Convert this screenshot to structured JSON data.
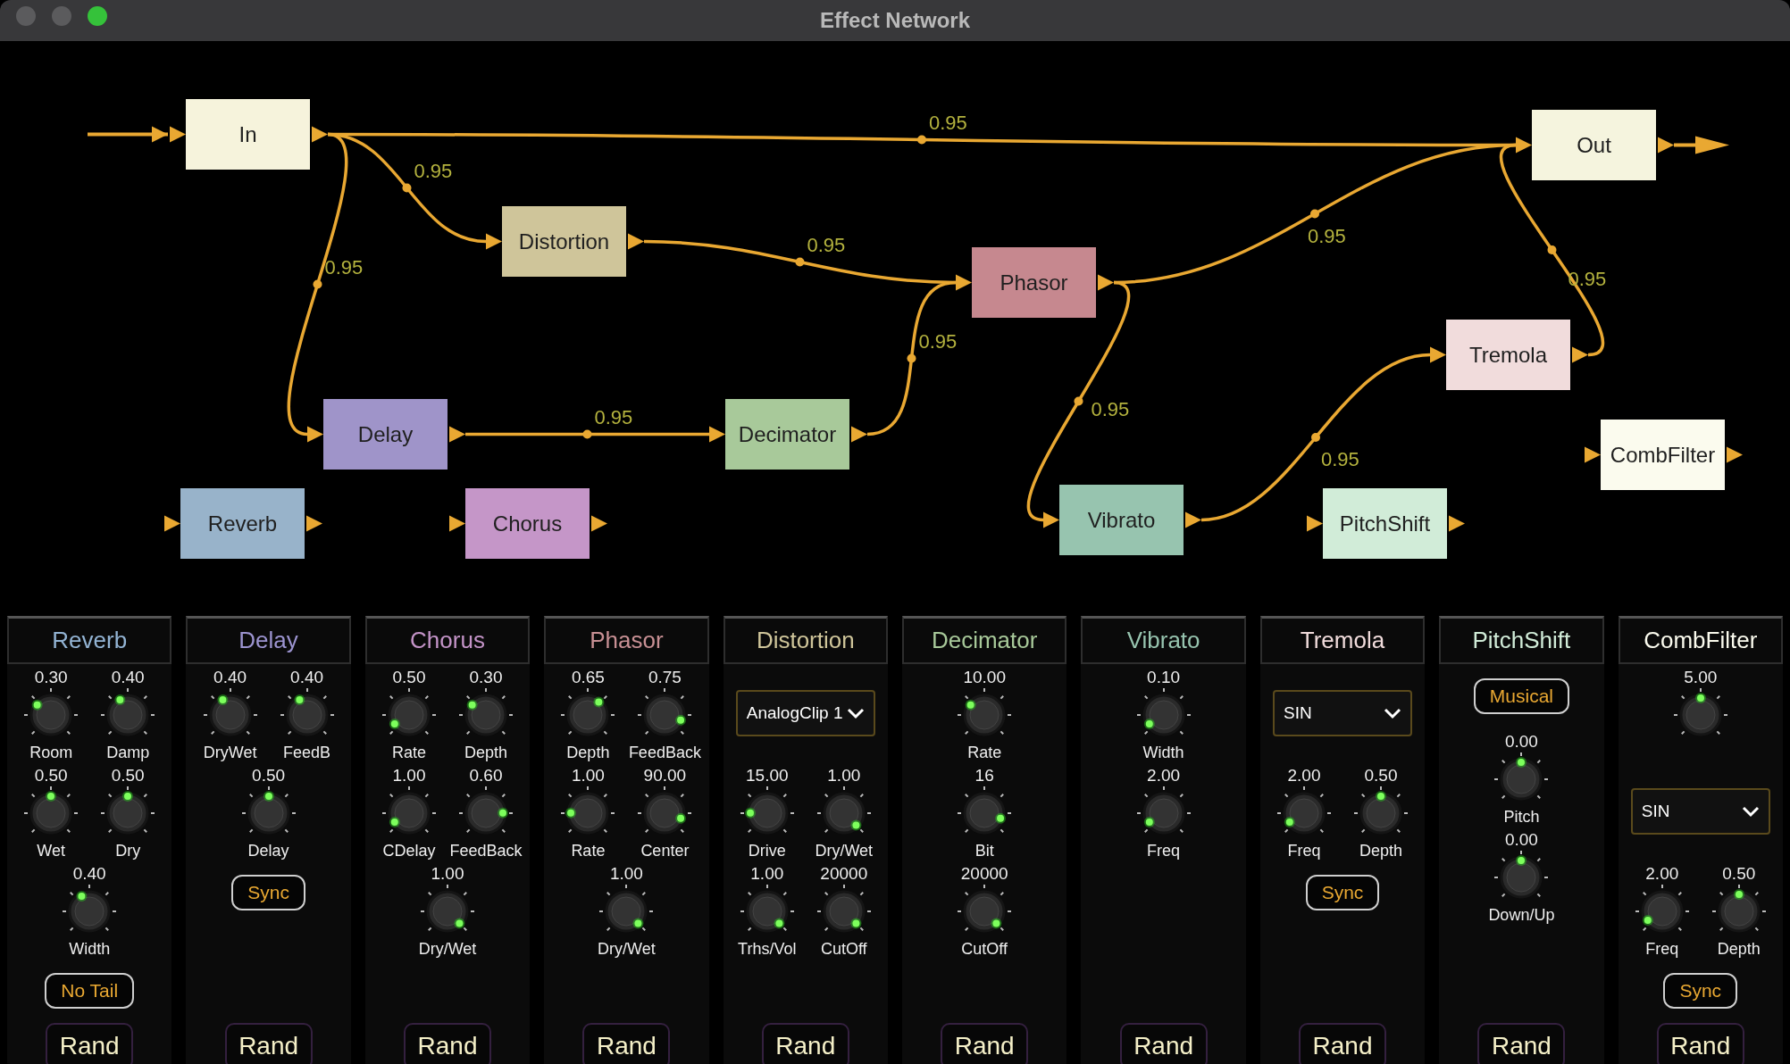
{
  "window": {
    "title": "Effect Network"
  },
  "graph": {
    "nodes": [
      {
        "label": "In",
        "kind": "input",
        "color": "#f6f3dc"
      },
      {
        "label": "Out",
        "kind": "output",
        "color": "#f5f4de"
      },
      {
        "label": "Distortion",
        "kind": "effect",
        "color": "#cfc59a"
      },
      {
        "label": "Phasor",
        "kind": "effect",
        "color": "#c6888f"
      },
      {
        "label": "Tremola",
        "kind": "effect",
        "color": "#f1dcdc"
      },
      {
        "label": "Delay",
        "kind": "effect",
        "color": "#9f94c9"
      },
      {
        "label": "Decimator",
        "kind": "effect",
        "color": "#a8c99a"
      },
      {
        "label": "CombFilter",
        "kind": "effect",
        "color": "#fbfbee"
      },
      {
        "label": "Reverb",
        "kind": "effect",
        "color": "#98b3ca"
      },
      {
        "label": "Chorus",
        "kind": "effect",
        "color": "#c596c8"
      },
      {
        "label": "Vibrato",
        "kind": "effect",
        "color": "#97c4af"
      },
      {
        "label": "PitchShift",
        "kind": "effect",
        "color": "#d1ecd8"
      }
    ],
    "edges": [
      {
        "weight": "0.95"
      },
      {
        "weight": "0.95"
      },
      {
        "weight": "0.95"
      },
      {
        "weight": "0.95"
      },
      {
        "weight": "0.95"
      },
      {
        "weight": "0.95"
      },
      {
        "weight": "0.95"
      },
      {
        "weight": "0.95"
      },
      {
        "weight": "0.95"
      },
      {
        "weight": "0.95"
      }
    ]
  },
  "panels": [
    {
      "title": "Reverb",
      "color": "#93b4d4",
      "rows": [
        {
          "kind": "knobs",
          "knobs": [
            {
              "value": "0.30",
              "label": "Room"
            },
            {
              "value": "0.40",
              "label": "Damp"
            }
          ]
        },
        {
          "kind": "knobs",
          "knobs": [
            {
              "value": "0.50",
              "label": "Wet"
            },
            {
              "value": "0.50",
              "label": "Dry"
            }
          ]
        },
        {
          "kind": "knobs",
          "knobs": [
            {
              "value": "0.40",
              "label": "Width"
            }
          ]
        },
        {
          "kind": "toggle",
          "label": "No Tail"
        }
      ],
      "button": "Rand"
    },
    {
      "title": "Delay",
      "color": "#9c94d0",
      "rows": [
        {
          "kind": "knobs",
          "knobs": [
            {
              "value": "0.40",
              "label": "DryWet"
            },
            {
              "value": "0.40",
              "label": "FeedB"
            }
          ]
        },
        {
          "kind": "knobs",
          "knobs": [
            {
              "value": "0.50",
              "label": "Delay"
            }
          ]
        },
        {
          "kind": "toggle",
          "label": "Sync"
        }
      ],
      "button": "Rand"
    },
    {
      "title": "Chorus",
      "color": "#c494c8",
      "rows": [
        {
          "kind": "knobs",
          "knobs": [
            {
              "value": "0.50",
              "label": "Rate"
            },
            {
              "value": "0.30",
              "label": "Depth"
            }
          ]
        },
        {
          "kind": "knobs",
          "knobs": [
            {
              "value": "1.00",
              "label": "CDelay"
            },
            {
              "value": "0.60",
              "label": "FeedBack"
            }
          ]
        },
        {
          "kind": "knobs",
          "knobs": [
            {
              "value": "1.00",
              "label": "Dry/Wet"
            }
          ]
        }
      ],
      "button": "Rand"
    },
    {
      "title": "Phasor",
      "color": "#c89094",
      "rows": [
        {
          "kind": "knobs",
          "knobs": [
            {
              "value": "0.65",
              "label": "Depth"
            },
            {
              "value": "0.75",
              "label": "FeedBack"
            }
          ]
        },
        {
          "kind": "knobs",
          "knobs": [
            {
              "value": "1.00",
              "label": "Rate"
            },
            {
              "value": "90.00",
              "label": "Center"
            }
          ]
        },
        {
          "kind": "knobs",
          "knobs": [
            {
              "value": "1.00",
              "label": "Dry/Wet"
            }
          ]
        }
      ],
      "button": "Rand"
    },
    {
      "title": "Distortion",
      "color": "#cfc59a",
      "rows": [
        {
          "kind": "dropdown",
          "value": "AnalogClip 1"
        },
        {
          "kind": "knobs",
          "knobs": [
            {
              "value": "15.00",
              "label": "Drive"
            },
            {
              "value": "1.00",
              "label": "Dry/Wet"
            }
          ]
        },
        {
          "kind": "knobs",
          "knobs": [
            {
              "value": "1.00",
              "label": "Trhs/Vol"
            },
            {
              "value": "20000",
              "label": "CutOff"
            }
          ]
        }
      ],
      "button": "Rand"
    },
    {
      "title": "Decimator",
      "color": "#a8c99a",
      "rows": [
        {
          "kind": "knobs",
          "knobs": [
            {
              "value": "10.00",
              "label": "Rate"
            }
          ]
        },
        {
          "kind": "knobs",
          "knobs": [
            {
              "value": "16",
              "label": "Bit"
            }
          ]
        },
        {
          "kind": "knobs",
          "knobs": [
            {
              "value": "20000",
              "label": "CutOff"
            }
          ]
        }
      ],
      "button": "Rand"
    },
    {
      "title": "Vibrato",
      "color": "#97c4af",
      "rows": [
        {
          "kind": "knobs",
          "knobs": [
            {
              "value": "0.10",
              "label": "Width"
            }
          ]
        },
        {
          "kind": "knobs",
          "knobs": [
            {
              "value": "2.00",
              "label": "Freq"
            }
          ]
        }
      ],
      "button": "Rand"
    },
    {
      "title": "Tremola",
      "color": "#f1dcdc",
      "rows": [
        {
          "kind": "dropdown",
          "value": "SIN"
        },
        {
          "kind": "knobs",
          "knobs": [
            {
              "value": "2.00",
              "label": "Freq"
            },
            {
              "value": "0.50",
              "label": "Depth"
            }
          ]
        },
        {
          "kind": "toggle",
          "label": "Sync"
        }
      ],
      "button": "Rand"
    },
    {
      "title": "PitchShift",
      "color": "#d1ecd8",
      "rows": [
        {
          "kind": "toggle",
          "label": "Musical"
        },
        {
          "kind": "knobs",
          "knobs": [
            {
              "value": "0.00",
              "label": "Pitch"
            }
          ]
        },
        {
          "kind": "knobs",
          "knobs": [
            {
              "value": "0.00",
              "label": "Down/Up"
            }
          ]
        }
      ],
      "button": "Rand"
    },
    {
      "title": "CombFilter",
      "color": "#fbfbee",
      "rows": [
        {
          "kind": "knobs",
          "knobs": [
            {
              "value": "5.00"
            }
          ]
        },
        {
          "kind": "dropdown",
          "value": "SIN"
        },
        {
          "kind": "knobs",
          "knobs": [
            {
              "value": "2.00",
              "label": "Freq"
            },
            {
              "value": "0.50",
              "label": "Depth"
            }
          ]
        },
        {
          "kind": "toggle",
          "label": "Sync"
        }
      ],
      "button": "Rand"
    }
  ]
}
